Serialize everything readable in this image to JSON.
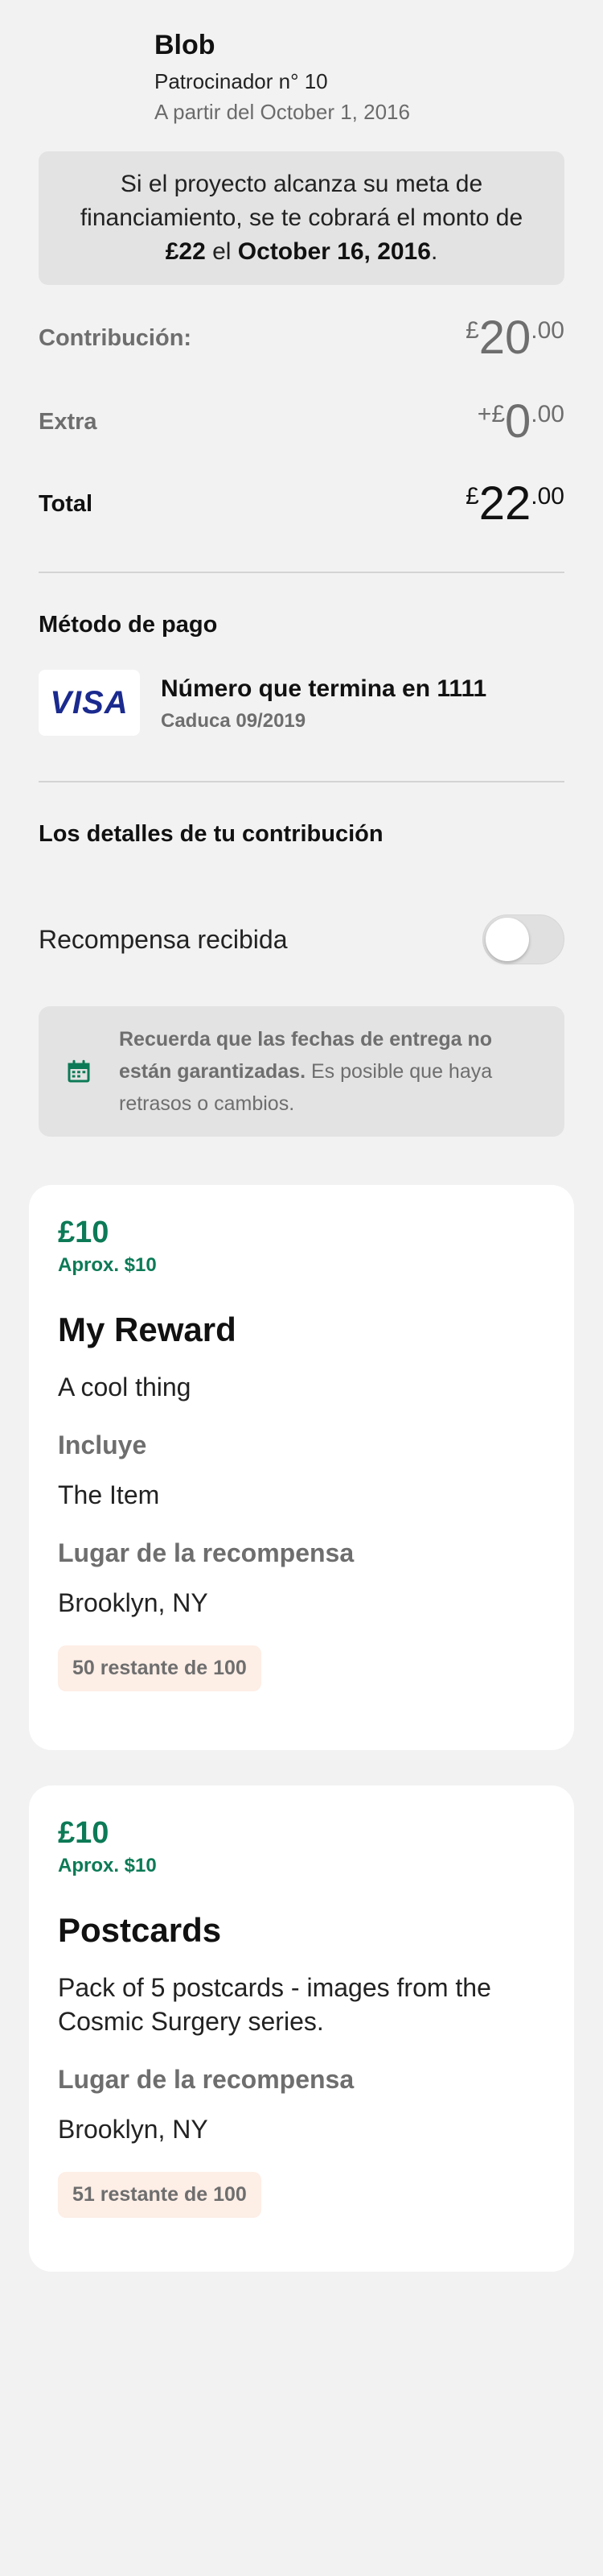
{
  "backer": {
    "name": "Blob",
    "number": "Patrocinador n° 10",
    "since": "A partir del October 1, 2016"
  },
  "notice": {
    "text_pre": "Si el proyecto alcanza su meta de financiamiento, se te cobrará el monto de ",
    "amount": "£22",
    "text_mid": " el ",
    "date": "October 16, 2016",
    "text_end": "."
  },
  "summary": {
    "contribution": {
      "label": "Contribución:",
      "currency": "£",
      "whole": "20",
      "cents": ".00"
    },
    "extra": {
      "label": "Extra",
      "currency": "+£",
      "whole": "0",
      "cents": ".00"
    },
    "total": {
      "label": "Total",
      "currency": "£",
      "whole": "22",
      "cents": ".00"
    }
  },
  "payment": {
    "title": "Método de pago",
    "card_brand": "VISA",
    "card_number": "Número que termina en 1111",
    "card_expiry": "Caduca 09/2019"
  },
  "details": {
    "title": "Los detalles de tu contribución",
    "reward_received_label": "Recompensa recibida",
    "reward_received": false,
    "delivery_note_bold": "Recuerda que las fechas de entrega no están garantizadas.",
    "delivery_note_rest": " Es posible que haya retrasos o cambios."
  },
  "rewards": [
    {
      "price": "£10",
      "approx": "Aprox. $10",
      "title": "My Reward",
      "description": "A cool thing",
      "includes_label": "Incluye",
      "includes_item": "The Item",
      "location_label": "Lugar de la recompensa",
      "location": "Brooklyn, NY",
      "remaining": "50 restante de 100"
    },
    {
      "price": "£10",
      "approx": "Aprox. $10",
      "title": "Postcards",
      "description": "Pack of 5 postcards - images from the Cosmic Surgery series.",
      "location_label": "Lugar de la recompensa",
      "location": "Brooklyn, NY",
      "remaining": "51 restante de 100"
    }
  ],
  "colors": {
    "accent_green": "#0c7a56",
    "visa_blue": "#1a2a8e",
    "badge_bg": "#fdeee6",
    "page_bg": "#f2f2f2"
  },
  "icons": {
    "payment": "visa-logo",
    "delivery_note": "calendar-icon"
  }
}
